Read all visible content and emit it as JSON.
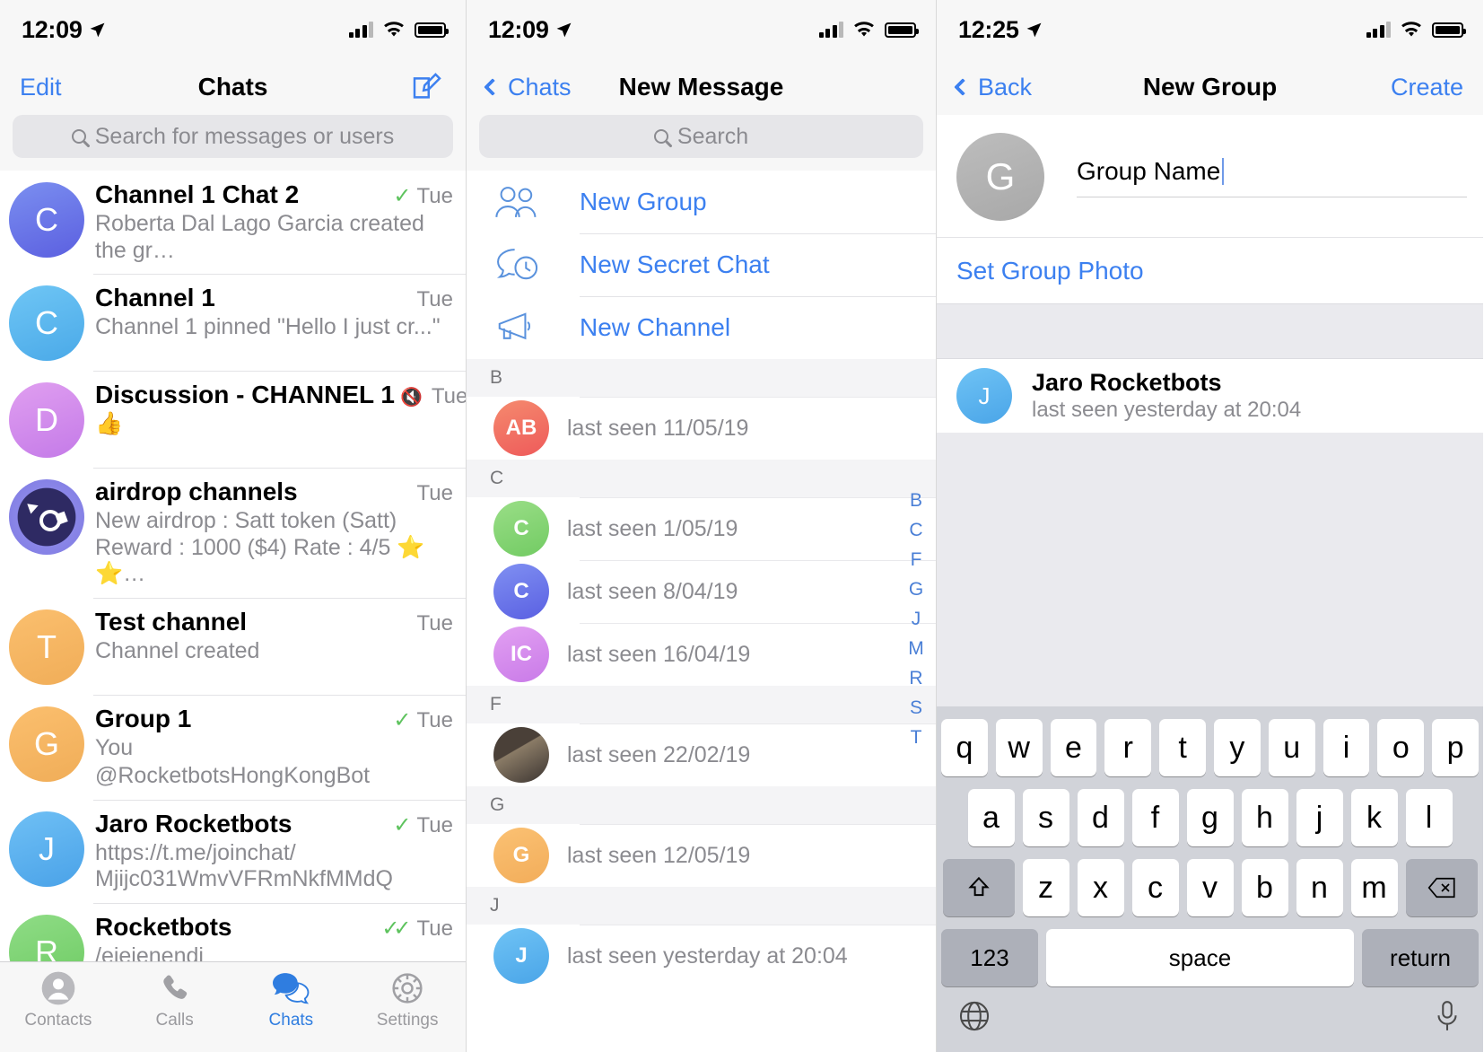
{
  "panel1": {
    "status": {
      "time": "12:09",
      "location_icon": "location-arrow-icon"
    },
    "nav": {
      "left_label": "Edit",
      "title": "Chats",
      "right_icon": "compose-icon"
    },
    "search": {
      "placeholder": "Search for messages or users",
      "icon": "search-icon"
    },
    "chats": [
      {
        "avatar_letter": "C",
        "name": "Channel 1 Chat 2",
        "muted": false,
        "tick": "✓",
        "time": "Tue",
        "preview": "Roberta Dal Lago Garcia created the gr…"
      },
      {
        "avatar_letter": "C",
        "name": "Channel 1",
        "muted": false,
        "tick": "",
        "time": "Tue",
        "preview": "Channel 1 pinned \"Hello I just cr...\""
      },
      {
        "avatar_letter": "D",
        "name": "Discussion - CHANNEL 1",
        "muted": true,
        "tick": "",
        "time": "Tue",
        "preview": "👍"
      },
      {
        "avatar_letter": "",
        "name": "airdrop channels",
        "muted": false,
        "tick": "",
        "time": "Tue",
        "preview": "New airdrop : Satt token  (Satt)\nReward : 1000  ($4)   Rate : 4/5 ⭐ ⭐…"
      },
      {
        "avatar_letter": "T",
        "name": "Test channel",
        "muted": false,
        "tick": "",
        "time": "Tue",
        "preview": "Channel created"
      },
      {
        "avatar_letter": "G",
        "name": "Group 1",
        "muted": false,
        "tick": "✓",
        "time": "Tue",
        "preview_you": "You",
        "preview": "@RocketbotsHongKongBot"
      },
      {
        "avatar_letter": "J",
        "name": "Jaro Rocketbots",
        "muted": false,
        "tick": "✓",
        "time": "Tue",
        "preview": "https://t.me/joinchat/\nMjijc031WmvVFRmNkfMMdQ"
      },
      {
        "avatar_letter": "R",
        "name": "Rocketbots",
        "muted": false,
        "tick": "✓✓",
        "time": "Tue",
        "preview": "/ejejenendj"
      }
    ],
    "tabs": [
      {
        "label": "Contacts",
        "icon": "contacts-icon",
        "active": false
      },
      {
        "label": "Calls",
        "icon": "phone-icon",
        "active": false
      },
      {
        "label": "Chats",
        "icon": "chats-bubble-icon",
        "active": true
      },
      {
        "label": "Settings",
        "icon": "gear-icon",
        "active": false
      }
    ]
  },
  "panel2": {
    "status": {
      "time": "12:09"
    },
    "nav": {
      "back_label": "Chats",
      "title": "New Message",
      "back_icon": "chevron-left-icon"
    },
    "search": {
      "placeholder": "Search",
      "icon": "search-icon"
    },
    "actions": [
      {
        "label": "New Group",
        "icon": "group-people-icon"
      },
      {
        "label": "New Secret Chat",
        "icon": "secret-chat-icon"
      },
      {
        "label": "New Channel",
        "icon": "megaphone-icon"
      }
    ],
    "sections": [
      {
        "letter": "B",
        "contacts": [
          {
            "initials": "AB",
            "avatar_style": "ab",
            "name": "",
            "status": "last seen 11/05/19"
          }
        ]
      },
      {
        "letter": "C",
        "contacts": [
          {
            "initials": "C",
            "avatar_style": "cg",
            "name": "",
            "status": "last seen 1/05/19"
          },
          {
            "initials": "C",
            "avatar_style": "cb",
            "name": "",
            "status": "last seen 8/04/19"
          },
          {
            "initials": "IC",
            "avatar_style": "ic",
            "name": "",
            "status": "last seen 16/04/19"
          }
        ]
      },
      {
        "letter": "F",
        "contacts": [
          {
            "initials": "",
            "avatar_style": "ph",
            "name": "",
            "status": "last seen 22/02/19"
          }
        ]
      },
      {
        "letter": "G",
        "contacts": [
          {
            "initials": "G",
            "avatar_style": "go",
            "name": "",
            "status": "last seen 12/05/19"
          }
        ]
      },
      {
        "letter": "J",
        "contacts": [
          {
            "initials": "J",
            "avatar_style": "jb",
            "name": "",
            "status": "last seen yesterday at 20:04"
          }
        ]
      }
    ],
    "index_letters": [
      "B",
      "C",
      "F",
      "G",
      "J",
      "M",
      "R",
      "S",
      "T"
    ]
  },
  "panel3": {
    "status": {
      "time": "12:25"
    },
    "nav": {
      "back_label": "Back",
      "title": "New Group",
      "action_label": "Create",
      "back_icon": "chevron-left-icon"
    },
    "group": {
      "avatar_letter": "G",
      "name_value": "Group Name",
      "set_photo_label": "Set Group Photo"
    },
    "members": [
      {
        "initials": "J",
        "name": "Jaro Rocketbots",
        "status": "last seen yesterday at 20:04"
      }
    ],
    "keyboard": {
      "row1": [
        "q",
        "w",
        "e",
        "r",
        "t",
        "y",
        "u",
        "i",
        "o",
        "p"
      ],
      "row2": [
        "a",
        "s",
        "d",
        "f",
        "g",
        "h",
        "j",
        "k",
        "l"
      ],
      "row3": [
        "z",
        "x",
        "c",
        "v",
        "b",
        "n",
        "m"
      ],
      "shift_icon": "shift-up-arrow-icon",
      "backspace_icon": "backspace-icon",
      "numbers_label": "123",
      "space_label": "space",
      "return_label": "return",
      "globe_icon": "globe-icon",
      "mic_icon": "microphone-icon"
    }
  },
  "colors": {
    "accent_blue": "#3c80f0",
    "tick_green": "#5ec35e",
    "muted_grey": "#8b8b90",
    "bar_bg": "#f7f7f7",
    "keyboard_bg": "#d1d3d9"
  }
}
